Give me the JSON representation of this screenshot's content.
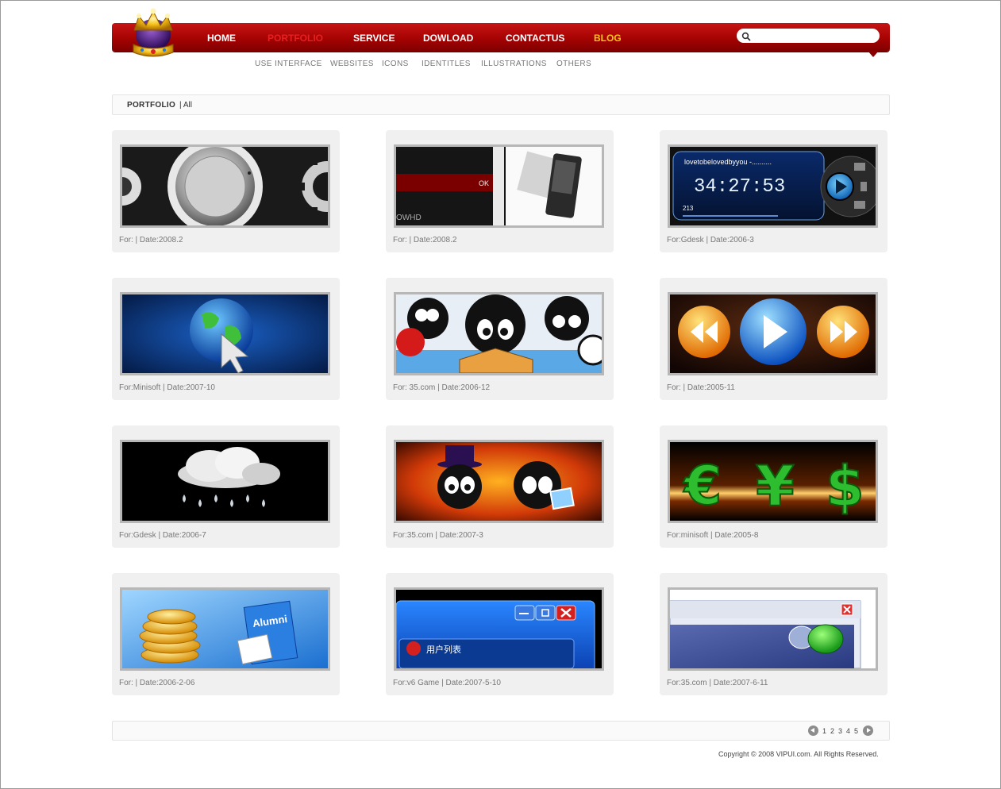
{
  "nav": {
    "items": [
      {
        "label": "HOME"
      },
      {
        "label": "PORTFOLIO"
      },
      {
        "label": "SERVICE"
      },
      {
        "label": "DOWLOAD"
      },
      {
        "label": "CONTACTUS"
      },
      {
        "label": "BLOG"
      }
    ],
    "active": "PORTFOLIO",
    "accent": "#e62020",
    "blog_color": "#ffc21a",
    "bar_color": "#a50303"
  },
  "search": {
    "value": "",
    "placeholder": ""
  },
  "subnav": [
    "USE INTERFACE",
    "WEBSITES",
    "ICONS",
    "IDENTITLES",
    "ILLUSTRATIONS",
    "OTHERS"
  ],
  "breadcrumb": {
    "section": "PORTFOLIO",
    "filter": "| All"
  },
  "portfolio": [
    {
      "caption": "For: | Date:2008.2",
      "image": "chrome-knob-gears"
    },
    {
      "caption": "For: | Date:2008.2",
      "image": "dark-ui-media-player-device"
    },
    {
      "caption": "For:Gdesk | Date:2006-3",
      "image": "music-player-skin"
    },
    {
      "caption": "For:Minisoft | Date:2007-10",
      "image": "globe-cursor-icon"
    },
    {
      "caption": "For: 35.com | Date:2006-12",
      "image": "cartoon-mascot-illustration"
    },
    {
      "caption": "For: | Date:2005-11",
      "image": "media-control-buttons"
    },
    {
      "caption": "For:Gdesk | Date:2006-7",
      "image": "rain-cloud-icon"
    },
    {
      "caption": "For:35.com | Date:2007-3",
      "image": "mascot-fire-illustration"
    },
    {
      "caption": "For:minisoft | Date:2005-8",
      "image": "currency-symbol-icons"
    },
    {
      "caption": "For: | Date:2006-2-06",
      "image": "coins-alumni-book-icons"
    },
    {
      "caption": "For:v6 Game | Date:2007-5-10",
      "image": "blue-game-window"
    },
    {
      "caption": "For:35.com | Date:2007-6-11",
      "image": "chat-window-icon"
    }
  ],
  "player_text": {
    "title": "lovetobelovedbyyou -..........",
    "time": "34:27:53",
    "count": "213"
  },
  "mockup_text": {
    "ok": "OK",
    "brand": "OWHD",
    "window_title": "用户列表",
    "alumni": "Alumni"
  },
  "pagination": {
    "pages": [
      "1",
      "2",
      "3",
      "4",
      "5"
    ]
  },
  "footer": {
    "copyright": "Copyright © 2008 VIPUI.com. All Rights Reserved."
  }
}
